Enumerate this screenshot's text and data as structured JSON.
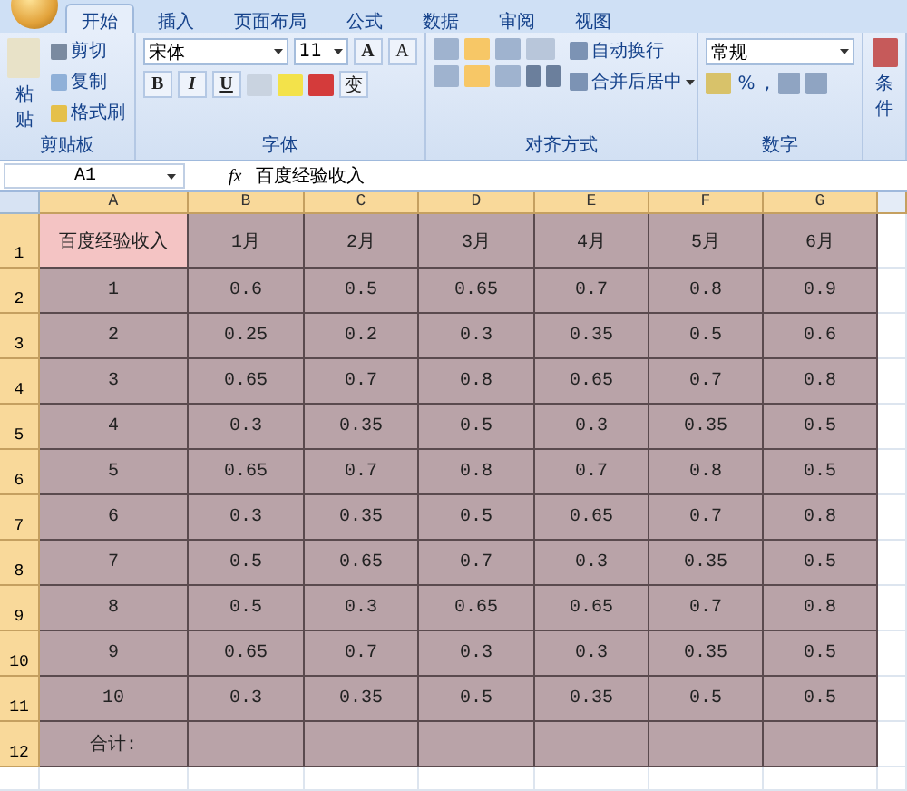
{
  "tabs": [
    {
      "label": "开始",
      "selected": true
    },
    {
      "label": "插入",
      "selected": false
    },
    {
      "label": "页面布局",
      "selected": false
    },
    {
      "label": "公式",
      "selected": false
    },
    {
      "label": "数据",
      "selected": false
    },
    {
      "label": "审阅",
      "selected": false
    },
    {
      "label": "视图",
      "selected": false
    }
  ],
  "ribbon": {
    "clipboard": {
      "label": "剪贴板",
      "paste": "粘贴",
      "cut": "剪切",
      "copy": "复制",
      "format_painter": "格式刷"
    },
    "font": {
      "label": "字体",
      "font_name": "宋体",
      "font_size": "11",
      "grow": "A",
      "shrink": "A",
      "bold": "B",
      "italic": "I",
      "underline": "U",
      "phonetic": "变"
    },
    "alignment": {
      "label": "对齐方式",
      "wrap_text": "自动换行",
      "merge_center": "合并后居中"
    },
    "number": {
      "label": "数字",
      "format": "常规",
      "percent": "%",
      "comma": ","
    },
    "styles": {
      "conditional": "条件"
    }
  },
  "formula_bar": {
    "name_box": "A1",
    "fx": "fx",
    "value": "百度经验收入"
  },
  "columns": [
    {
      "label": "A",
      "highlighted": true
    },
    {
      "label": "B",
      "highlighted": true
    },
    {
      "label": "C",
      "highlighted": true
    },
    {
      "label": "D",
      "highlighted": true
    },
    {
      "label": "E",
      "highlighted": true
    },
    {
      "label": "F",
      "highlighted": true
    },
    {
      "label": "G",
      "highlighted": true
    }
  ],
  "rows": [
    {
      "number": "1",
      "cells": [
        {
          "text": "百度经验收入",
          "selected": true
        },
        {
          "text": "1月",
          "selected": false
        },
        {
          "text": "2月",
          "selected": false
        },
        {
          "text": "3月",
          "selected": false
        },
        {
          "text": "4月",
          "selected": false
        },
        {
          "text": "5月",
          "selected": false
        },
        {
          "text": "6月",
          "selected": false
        }
      ]
    },
    {
      "number": "2",
      "cells": [
        {
          "text": "1",
          "selected": false
        },
        {
          "text": "0.6",
          "selected": false
        },
        {
          "text": "0.5",
          "selected": false
        },
        {
          "text": "0.65",
          "selected": false
        },
        {
          "text": "0.7",
          "selected": false
        },
        {
          "text": "0.8",
          "selected": false
        },
        {
          "text": "0.9",
          "selected": false
        }
      ]
    },
    {
      "number": "3",
      "cells": [
        {
          "text": "2",
          "selected": false
        },
        {
          "text": "0.25",
          "selected": false
        },
        {
          "text": "0.2",
          "selected": false
        },
        {
          "text": "0.3",
          "selected": false
        },
        {
          "text": "0.35",
          "selected": false
        },
        {
          "text": "0.5",
          "selected": false
        },
        {
          "text": "0.6",
          "selected": false
        }
      ]
    },
    {
      "number": "4",
      "cells": [
        {
          "text": "3",
          "selected": false
        },
        {
          "text": "0.65",
          "selected": false
        },
        {
          "text": "0.7",
          "selected": false
        },
        {
          "text": "0.8",
          "selected": false
        },
        {
          "text": "0.65",
          "selected": false
        },
        {
          "text": "0.7",
          "selected": false
        },
        {
          "text": "0.8",
          "selected": false
        }
      ]
    },
    {
      "number": "5",
      "cells": [
        {
          "text": "4",
          "selected": false
        },
        {
          "text": "0.3",
          "selected": false
        },
        {
          "text": "0.35",
          "selected": false
        },
        {
          "text": "0.5",
          "selected": false
        },
        {
          "text": "0.3",
          "selected": false
        },
        {
          "text": "0.35",
          "selected": false
        },
        {
          "text": "0.5",
          "selected": false
        }
      ]
    },
    {
      "number": "6",
      "cells": [
        {
          "text": "5",
          "selected": false
        },
        {
          "text": "0.65",
          "selected": false
        },
        {
          "text": "0.7",
          "selected": false
        },
        {
          "text": "0.8",
          "selected": false
        },
        {
          "text": "0.7",
          "selected": false
        },
        {
          "text": "0.8",
          "selected": false
        },
        {
          "text": "0.5",
          "selected": false
        }
      ]
    },
    {
      "number": "7",
      "cells": [
        {
          "text": "6",
          "selected": false
        },
        {
          "text": "0.3",
          "selected": false
        },
        {
          "text": "0.35",
          "selected": false
        },
        {
          "text": "0.5",
          "selected": false
        },
        {
          "text": "0.65",
          "selected": false
        },
        {
          "text": "0.7",
          "selected": false
        },
        {
          "text": "0.8",
          "selected": false
        }
      ]
    },
    {
      "number": "8",
      "cells": [
        {
          "text": "7",
          "selected": false
        },
        {
          "text": "0.5",
          "selected": false
        },
        {
          "text": "0.65",
          "selected": false
        },
        {
          "text": "0.7",
          "selected": false
        },
        {
          "text": "0.3",
          "selected": false
        },
        {
          "text": "0.35",
          "selected": false
        },
        {
          "text": "0.5",
          "selected": false
        }
      ]
    },
    {
      "number": "9",
      "cells": [
        {
          "text": "8",
          "selected": false
        },
        {
          "text": "0.5",
          "selected": false
        },
        {
          "text": "0.3",
          "selected": false
        },
        {
          "text": "0.65",
          "selected": false
        },
        {
          "text": "0.65",
          "selected": false
        },
        {
          "text": "0.7",
          "selected": false
        },
        {
          "text": "0.8",
          "selected": false
        }
      ]
    },
    {
      "number": "10",
      "cells": [
        {
          "text": "9",
          "selected": false
        },
        {
          "text": "0.65",
          "selected": false
        },
        {
          "text": "0.7",
          "selected": false
        },
        {
          "text": "0.3",
          "selected": false
        },
        {
          "text": "0.3",
          "selected": false
        },
        {
          "text": "0.35",
          "selected": false
        },
        {
          "text": "0.5",
          "selected": false
        }
      ]
    },
    {
      "number": "11",
      "cells": [
        {
          "text": "10",
          "selected": false
        },
        {
          "text": "0.3",
          "selected": false
        },
        {
          "text": "0.35",
          "selected": false
        },
        {
          "text": "0.5",
          "selected": false
        },
        {
          "text": "0.35",
          "selected": false
        },
        {
          "text": "0.5",
          "selected": false
        },
        {
          "text": "0.5",
          "selected": false
        }
      ]
    },
    {
      "number": "12",
      "cells": [
        {
          "text": "合计:",
          "selected": false
        },
        {
          "text": "",
          "selected": false
        },
        {
          "text": "",
          "selected": false
        },
        {
          "text": "",
          "selected": false
        },
        {
          "text": "",
          "selected": false
        },
        {
          "text": "",
          "selected": false
        },
        {
          "text": "",
          "selected": false
        }
      ]
    }
  ]
}
